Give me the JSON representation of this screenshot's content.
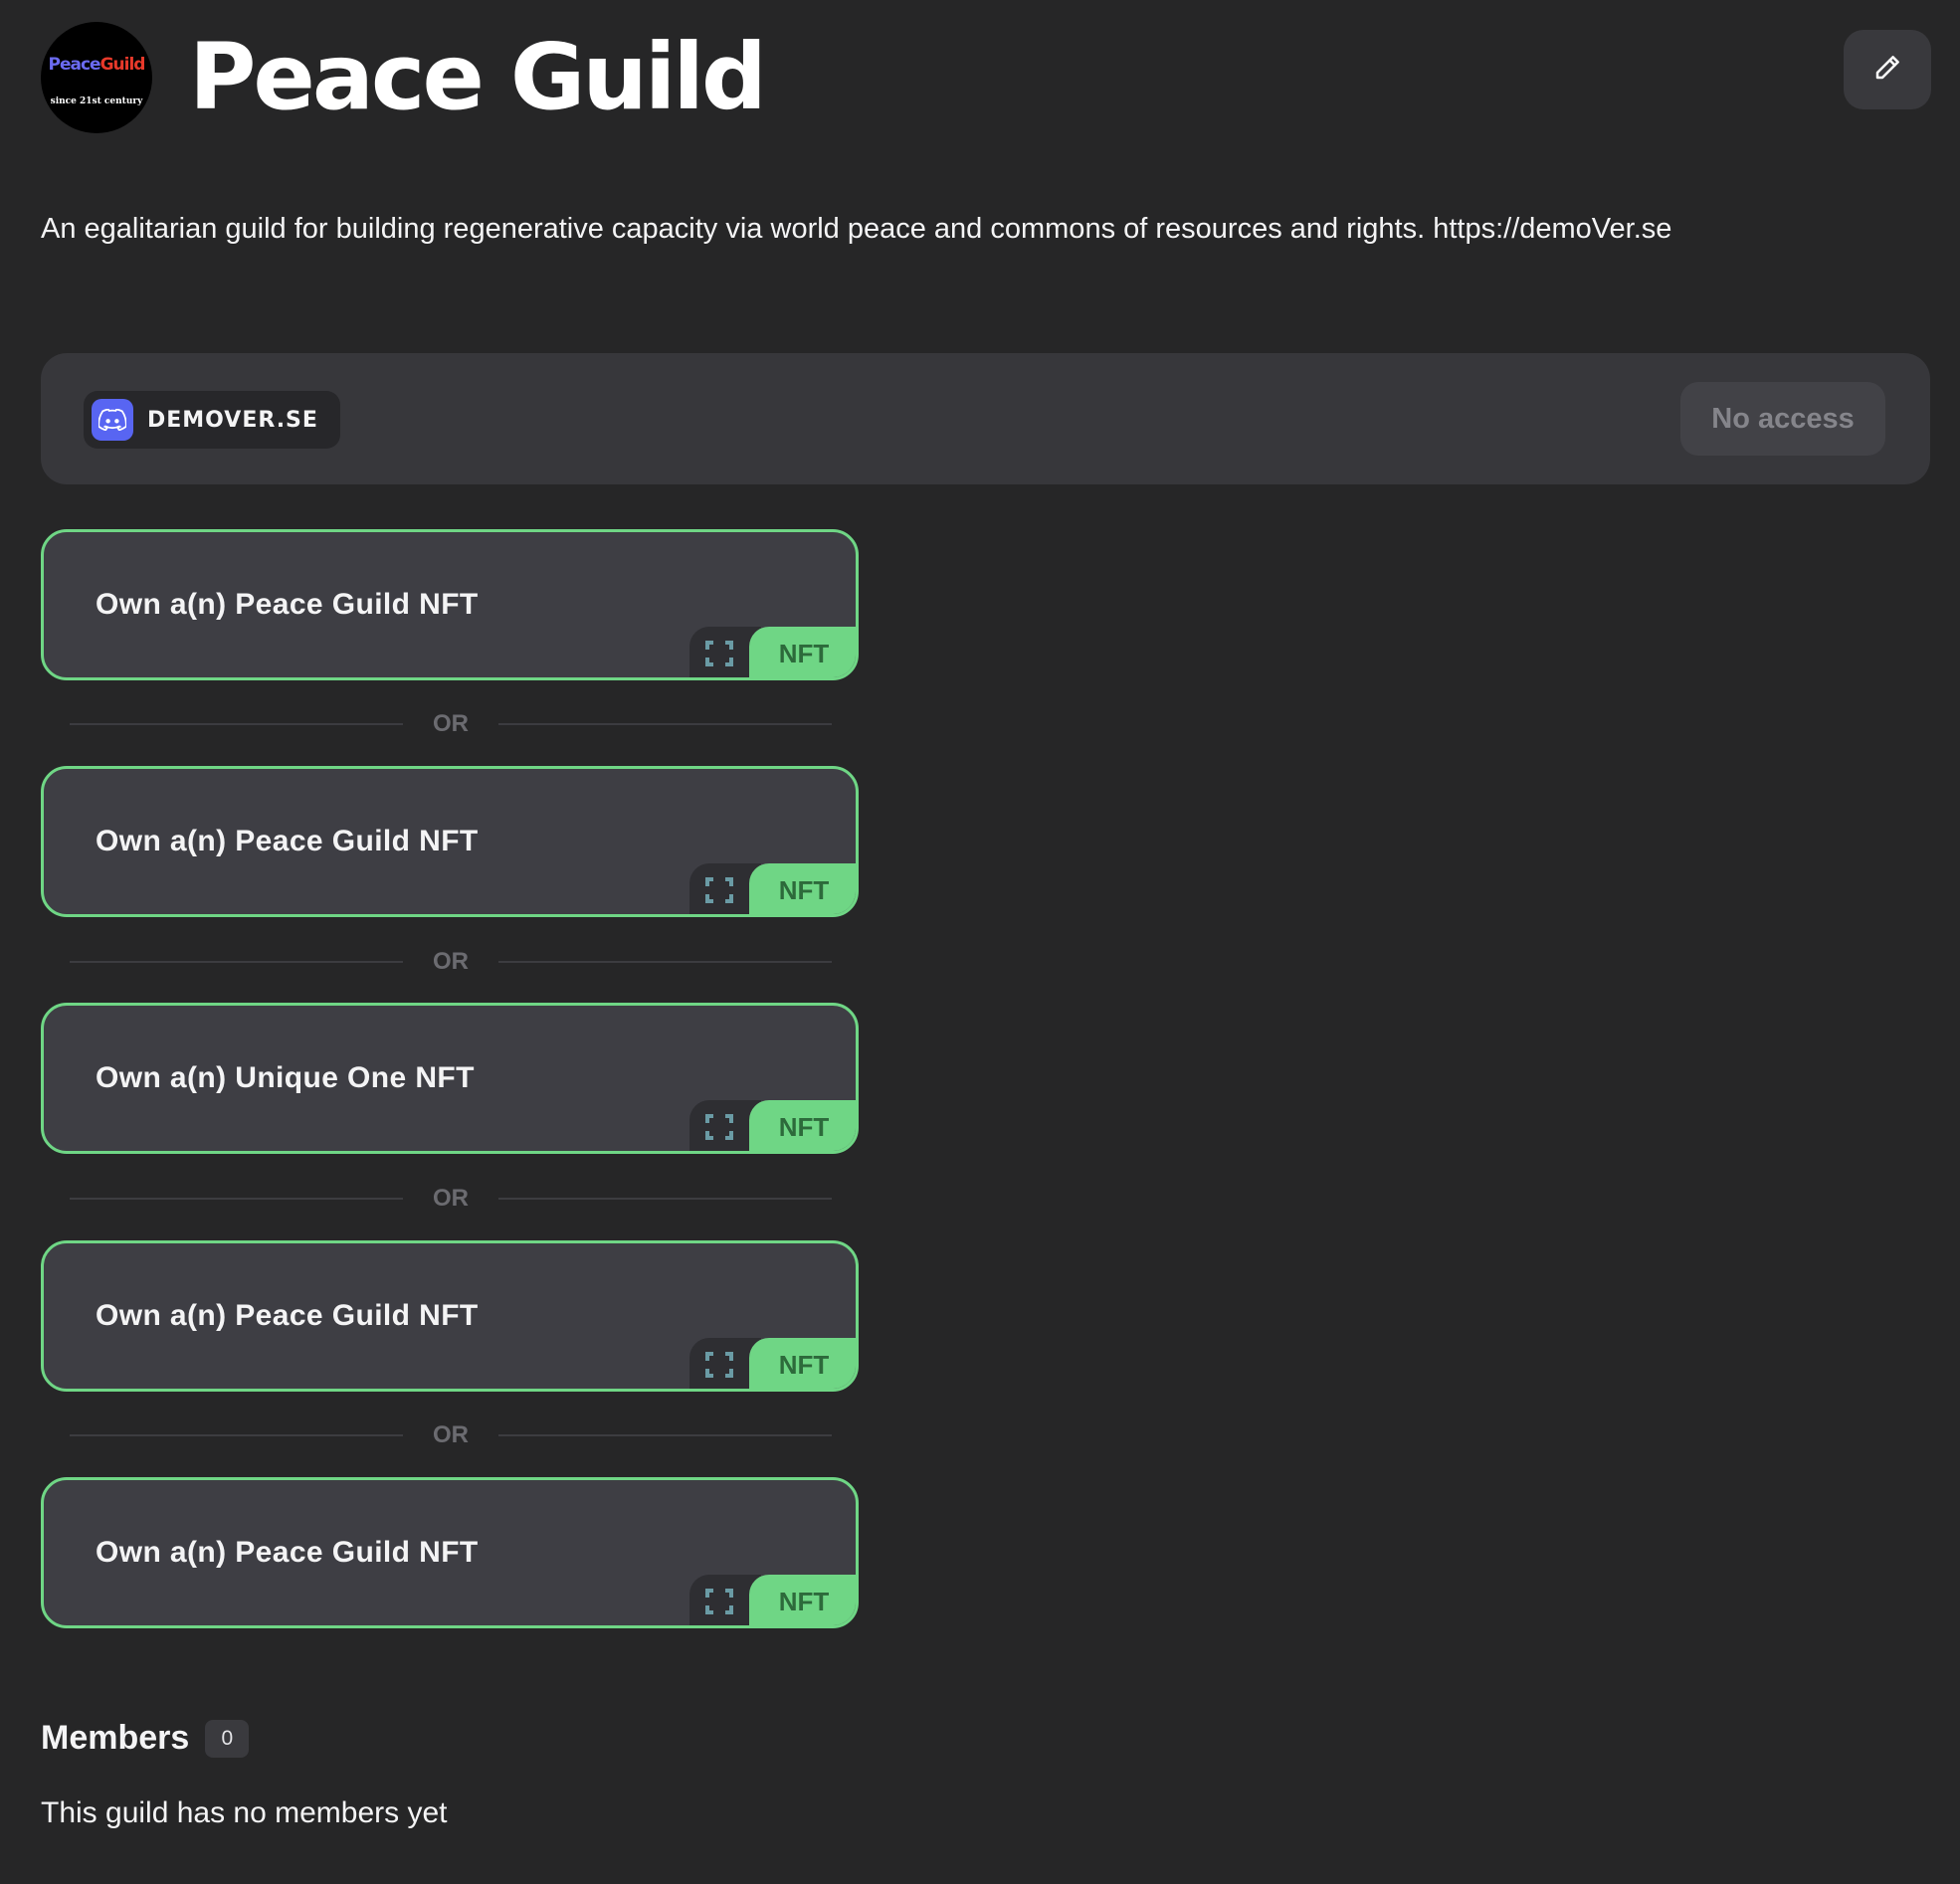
{
  "header": {
    "logo_text_peace": "Peace",
    "logo_text_guild": "Guild",
    "logo_subtitle": "since 21st century",
    "title": "Peace Guild",
    "edit_icon": "pencil-icon"
  },
  "description": "An egalitarian guild for building regenerative capacity via world peace and commons of resources and rights. https://demoVer.se",
  "role": {
    "platform_icon": "discord-icon",
    "platform_label": "DEMOVER.SE",
    "access_button": "No access"
  },
  "requirements": [
    {
      "label": "Own a(n) Peace Guild NFT",
      "type": "NFT"
    },
    {
      "label": "Own a(n) Peace Guild NFT",
      "type": "NFT"
    },
    {
      "label": "Own a(n) Unique One NFT",
      "type": "NFT"
    },
    {
      "label": "Own a(n) Peace Guild NFT",
      "type": "NFT"
    },
    {
      "label": "Own a(n) Peace Guild NFT",
      "type": "NFT"
    }
  ],
  "or_label": "OR",
  "members": {
    "title": "Members",
    "count": "0",
    "empty_text": "This guild has no members yet"
  },
  "colors": {
    "background": "#262627",
    "card": "#37373b",
    "requirement_border": "#6fd685",
    "nft_tag": "#6fd685",
    "discord": "#5865f2"
  }
}
